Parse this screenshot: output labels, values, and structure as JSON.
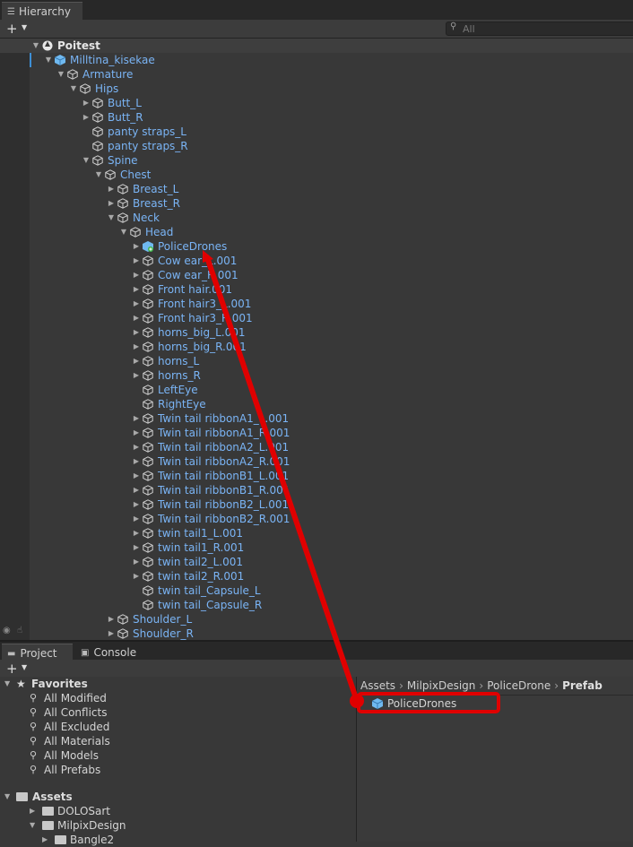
{
  "hierarchy": {
    "tab_label": "Hierarchy",
    "search_placeholder": "All",
    "rows": [
      {
        "label": "Poitest",
        "depth": 0,
        "fold": "open",
        "icon": "unity-scene-icon"
      },
      {
        "label": "Milltina_kisekae",
        "depth": 1,
        "fold": "open",
        "icon": "prefab-icon"
      },
      {
        "label": "Armature",
        "depth": 2,
        "fold": "open",
        "icon": "cube-icon"
      },
      {
        "label": "Hips",
        "depth": 3,
        "fold": "open",
        "icon": "cube-icon"
      },
      {
        "label": "Butt_L",
        "depth": 4,
        "fold": "closed",
        "icon": "cube-icon"
      },
      {
        "label": "Butt_R",
        "depth": 4,
        "fold": "closed",
        "icon": "cube-icon"
      },
      {
        "label": "panty straps_L",
        "depth": 4,
        "fold": "none",
        "icon": "cube-icon"
      },
      {
        "label": "panty straps_R",
        "depth": 4,
        "fold": "none",
        "icon": "cube-icon"
      },
      {
        "label": "Spine",
        "depth": 4,
        "fold": "open",
        "icon": "cube-icon"
      },
      {
        "label": "Chest",
        "depth": 5,
        "fold": "open",
        "icon": "cube-icon"
      },
      {
        "label": "Breast_L",
        "depth": 6,
        "fold": "closed",
        "icon": "cube-icon"
      },
      {
        "label": "Breast_R",
        "depth": 6,
        "fold": "closed",
        "icon": "cube-icon"
      },
      {
        "label": "Neck",
        "depth": 6,
        "fold": "open",
        "icon": "cube-icon"
      },
      {
        "label": "Head",
        "depth": 7,
        "fold": "open",
        "icon": "cube-icon"
      },
      {
        "label": "PoliceDrones",
        "depth": 8,
        "fold": "closed",
        "icon": "prefab-added-icon"
      },
      {
        "label": "Cow ear_L.001",
        "depth": 8,
        "fold": "closed",
        "icon": "cube-icon"
      },
      {
        "label": "Cow ear_R.001",
        "depth": 8,
        "fold": "closed",
        "icon": "cube-icon"
      },
      {
        "label": "Front hair.001",
        "depth": 8,
        "fold": "closed",
        "icon": "cube-icon"
      },
      {
        "label": "Front hair3_L.001",
        "depth": 8,
        "fold": "closed",
        "icon": "cube-icon"
      },
      {
        "label": "Front hair3_R.001",
        "depth": 8,
        "fold": "closed",
        "icon": "cube-icon"
      },
      {
        "label": "horns_big_L.001",
        "depth": 8,
        "fold": "closed",
        "icon": "cube-icon"
      },
      {
        "label": "horns_big_R.001",
        "depth": 8,
        "fold": "closed",
        "icon": "cube-icon"
      },
      {
        "label": "horns_L",
        "depth": 8,
        "fold": "closed",
        "icon": "cube-icon"
      },
      {
        "label": "horns_R",
        "depth": 8,
        "fold": "closed",
        "icon": "cube-icon"
      },
      {
        "label": "LeftEye",
        "depth": 8,
        "fold": "none",
        "icon": "cube-icon"
      },
      {
        "label": "RightEye",
        "depth": 8,
        "fold": "none",
        "icon": "cube-icon"
      },
      {
        "label": "Twin tail ribbonA1_L.001",
        "depth": 8,
        "fold": "closed",
        "icon": "cube-icon"
      },
      {
        "label": "Twin tail ribbonA1_R.001",
        "depth": 8,
        "fold": "closed",
        "icon": "cube-icon"
      },
      {
        "label": "Twin tail ribbonA2_L.001",
        "depth": 8,
        "fold": "closed",
        "icon": "cube-icon"
      },
      {
        "label": "Twin tail ribbonA2_R.001",
        "depth": 8,
        "fold": "closed",
        "icon": "cube-icon"
      },
      {
        "label": "Twin tail ribbonB1_L.001",
        "depth": 8,
        "fold": "closed",
        "icon": "cube-icon"
      },
      {
        "label": "Twin tail ribbonB1_R.001",
        "depth": 8,
        "fold": "closed",
        "icon": "cube-icon"
      },
      {
        "label": "Twin tail ribbonB2_L.001",
        "depth": 8,
        "fold": "closed",
        "icon": "cube-icon"
      },
      {
        "label": "Twin tail ribbonB2_R.001",
        "depth": 8,
        "fold": "closed",
        "icon": "cube-icon"
      },
      {
        "label": "twin tail1_L.001",
        "depth": 8,
        "fold": "closed",
        "icon": "cube-icon"
      },
      {
        "label": "twin tail1_R.001",
        "depth": 8,
        "fold": "closed",
        "icon": "cube-icon"
      },
      {
        "label": "twin tail2_L.001",
        "depth": 8,
        "fold": "closed",
        "icon": "cube-icon"
      },
      {
        "label": "twin tail2_R.001",
        "depth": 8,
        "fold": "closed",
        "icon": "cube-icon"
      },
      {
        "label": "twin tail_Capsule_L",
        "depth": 8,
        "fold": "none",
        "icon": "cube-icon"
      },
      {
        "label": "twin tail_Capsule_R",
        "depth": 8,
        "fold": "none",
        "icon": "cube-icon"
      },
      {
        "label": "Shoulder_L",
        "depth": 6,
        "fold": "closed",
        "icon": "cube-icon"
      },
      {
        "label": "Shoulder_R",
        "depth": 6,
        "fold": "closed",
        "icon": "cube-icon"
      }
    ]
  },
  "bottom": {
    "tabs": [
      {
        "label": "Project",
        "icon": "folder-icon"
      },
      {
        "label": "Console",
        "icon": "console-icon"
      }
    ]
  },
  "project": {
    "favorites_label": "Favorites",
    "favorites": [
      "All Modified",
      "All Conflicts",
      "All Excluded",
      "All Materials",
      "All Models",
      "All Prefabs"
    ],
    "assets_label": "Assets",
    "folders": [
      {
        "label": "DOLOSart",
        "fold": "closed",
        "depth": 1
      },
      {
        "label": "MilpixDesign",
        "fold": "open",
        "depth": 1
      },
      {
        "label": "Bangle2",
        "fold": "closed",
        "depth": 2
      }
    ]
  },
  "assets_view": {
    "breadcrumb": [
      "Assets",
      "MilpixDesign",
      "PoliceDrone",
      "Prefab"
    ],
    "item": {
      "label": "PoliceDrones",
      "icon": "prefab-icon"
    }
  },
  "colors": {
    "annotation": "#e00000",
    "link_text": "#7ab4f5",
    "selection": "#3d8fd6"
  }
}
